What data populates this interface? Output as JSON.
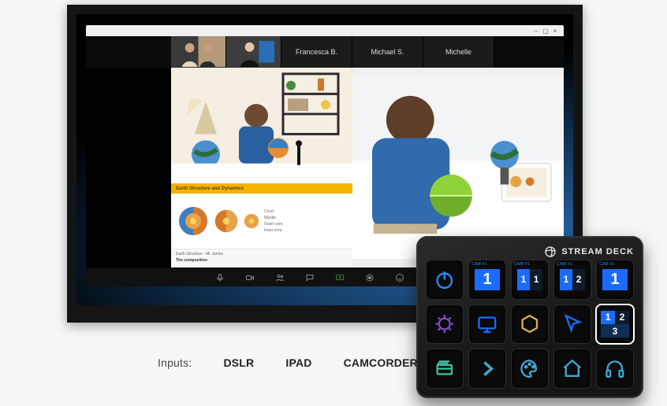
{
  "participants": {
    "names": [
      "Francesca B.",
      "Michael S.",
      "Michelle"
    ]
  },
  "slide": {
    "title": "Earth Structure and Dynamics",
    "items": [
      "Crust",
      "Mantle",
      "Outer core",
      "Inner core"
    ],
    "footer_left": "Earth Structure - Mr James",
    "footer_heading": "The composition"
  },
  "inputs": {
    "label": "Inputs:",
    "options": [
      "DSLR",
      "IPAD",
      "CAMCORDER"
    ]
  },
  "streamdeck": {
    "brand": "STREAM DECK",
    "keys": [
      {
        "type": "power"
      },
      {
        "type": "cam-single",
        "miniLabel": "CAM #1",
        "value": "1"
      },
      {
        "type": "cam-split2",
        "miniLabel": "CAM #1",
        "values": [
          "1",
          "1"
        ]
      },
      {
        "type": "cam-split2",
        "miniLabel": "CAM #1",
        "values": [
          "1",
          "2"
        ]
      },
      {
        "type": "cam-single",
        "miniLabel": "CAM #1",
        "value": "1"
      },
      {
        "type": "scene",
        "tint": "purple"
      },
      {
        "type": "monitor",
        "tint": "blue"
      },
      {
        "type": "hex",
        "tint": "yellow"
      },
      {
        "type": "cursor",
        "tint": "blue"
      },
      {
        "type": "cam-split3",
        "miniLabel": "",
        "values": [
          "1",
          "2",
          "3"
        ],
        "selected": true
      },
      {
        "type": "film",
        "tint": "teal"
      },
      {
        "type": "chevron",
        "tint": "cyan"
      },
      {
        "type": "palette",
        "tint": "cyan"
      },
      {
        "type": "home",
        "tint": "cyan"
      },
      {
        "type": "headphones",
        "tint": "cyan"
      }
    ]
  }
}
